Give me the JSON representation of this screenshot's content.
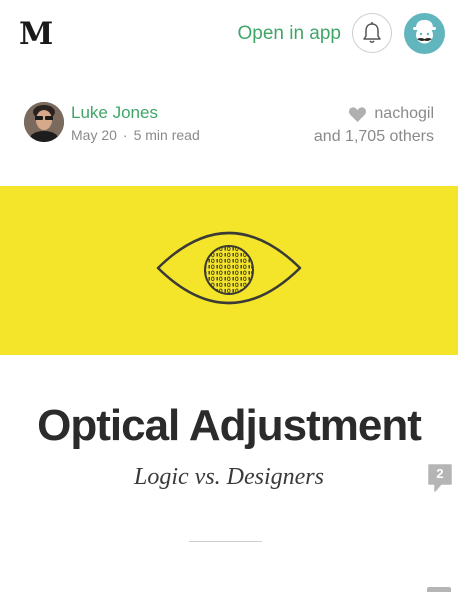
{
  "header": {
    "logo": "M",
    "open_in_app": "Open in app",
    "icons": {
      "notifications": "bell-icon",
      "profile": "user-avatar"
    },
    "accent_color": "#3fa668",
    "avatar_bg": "#61b5bd"
  },
  "author": {
    "name": "Luke Jones",
    "date": "May 20",
    "separator": "·",
    "read_time": "5 min read"
  },
  "recommendations": {
    "icon": "heart-icon",
    "recommender": "nachogil",
    "others": "and 1,705 others"
  },
  "hero": {
    "background_color": "#f4e42a",
    "illustration": "eye-icon"
  },
  "article": {
    "title": "Optical Adjustment",
    "subtitle": "Logic vs. Designers",
    "comment_count": "2"
  }
}
